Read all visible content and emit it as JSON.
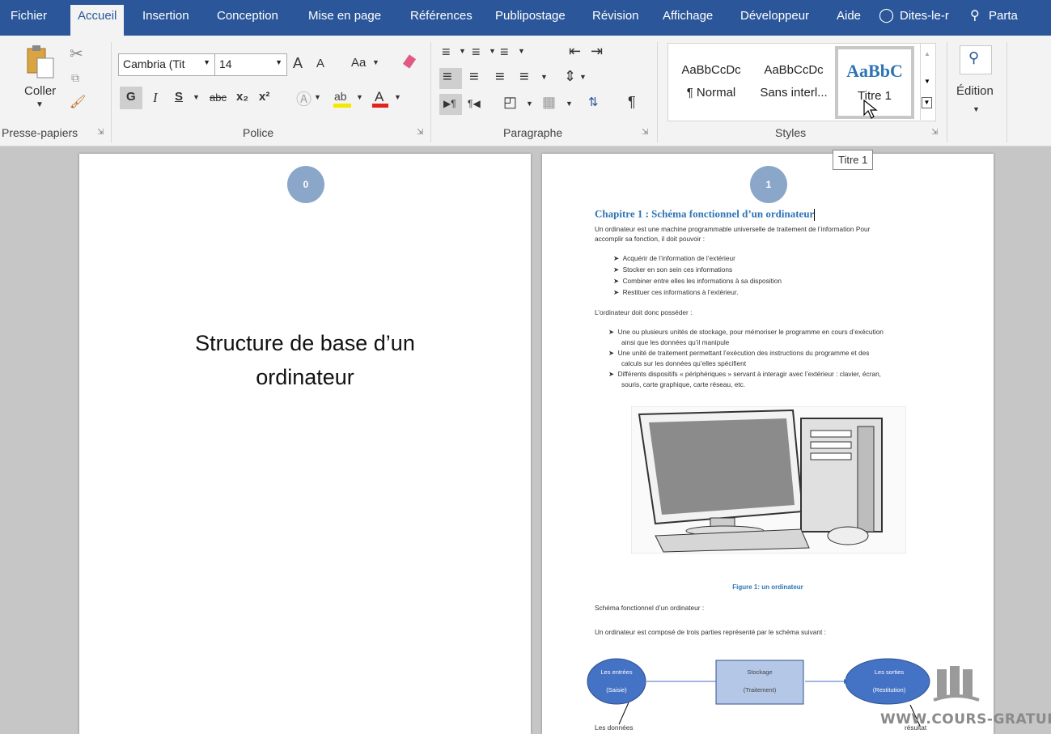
{
  "menu": {
    "items": [
      "Fichier",
      "Accueil",
      "Insertion",
      "Conception",
      "Mise en page",
      "Références",
      "Publipostage",
      "Révision",
      "Affichage",
      "Développeur",
      "Aide"
    ],
    "tell_me": "Dites-le-r",
    "share": "Parta"
  },
  "ribbon": {
    "clipboard": {
      "paste_label": "Coller",
      "group_label": "Presse-papiers"
    },
    "font": {
      "font_name": "Cambria (Tit",
      "font_size": "14",
      "bold": "G",
      "italic": "I",
      "underline": "S",
      "strike": "abc",
      "sub": "x₂",
      "sup": "x²",
      "case": "Aa",
      "grow": "A",
      "shrink": "A",
      "group_label": "Police"
    },
    "paragraph": {
      "group_label": "Paragraphe"
    },
    "styles": {
      "items": [
        {
          "preview": "AaBbCcDc",
          "label": "¶ Normal"
        },
        {
          "preview": "AaBbCcDc",
          "label": "Sans interl..."
        },
        {
          "preview": "AaBbC",
          "label": "Titre 1"
        }
      ],
      "group_label": "Styles"
    },
    "editing": {
      "label": "Édition"
    }
  },
  "tooltip": "Titre 1",
  "page1": {
    "number": "0",
    "title_line1": "Structure de base d’un",
    "title_line2": "ordinateur"
  },
  "page2": {
    "number": "1",
    "heading": "Chapitre 1 : Schéma fonctionnel d’un ordinateur",
    "intro_line1": "Un ordinateur est une machine programmable universelle de traitement de l’information Pour",
    "intro_line2": "accomplir sa fonction, il doit pouvoir :",
    "bullets1": [
      "Acquérir de l’information de l’extérieur",
      "Stocker en son sein ces informations",
      "Combiner entre elles les informations à sa disposition",
      "Restituer ces informations à l’extérieur."
    ],
    "must_have": "L’ordinateur doit donc posséder :",
    "bullets2": [
      {
        "l1": "Une ou plusieurs unités de stockage, pour mémoriser le programme en cours d’exécution",
        "l2": "ainsi que les données qu’il manipule"
      },
      {
        "l1": "Une unité de traitement permettant l’exécution des instructions du programme et des",
        "l2": "calculs sur les données qu’elles spécifient"
      },
      {
        "l1": "Différents dispositifs « périphériques » servant à interagir avec l’extérieur : clavier, écran,",
        "l2": "souris, carte graphique, carte réseau, etc."
      }
    ],
    "figure_caption": "Figure 1: un ordinateur",
    "schema_title": "Schéma fonctionnel d’un ordinateur :",
    "schema_intro": "Un ordinateur est composé de trois parties  représenté  par le  schéma suivant :",
    "diagram": {
      "inputs_l1": "Les entrées",
      "inputs_l2": "(Saisie)",
      "storage_l1": "Stockage",
      "storage_l2": "(Traitement)",
      "outputs_l1": "Les sorties",
      "outputs_l2": "(Restitution)",
      "data_label": "Les données",
      "result_label": "résultat"
    }
  },
  "watermark": "WWW.COURS-GRATUIT.COM"
}
